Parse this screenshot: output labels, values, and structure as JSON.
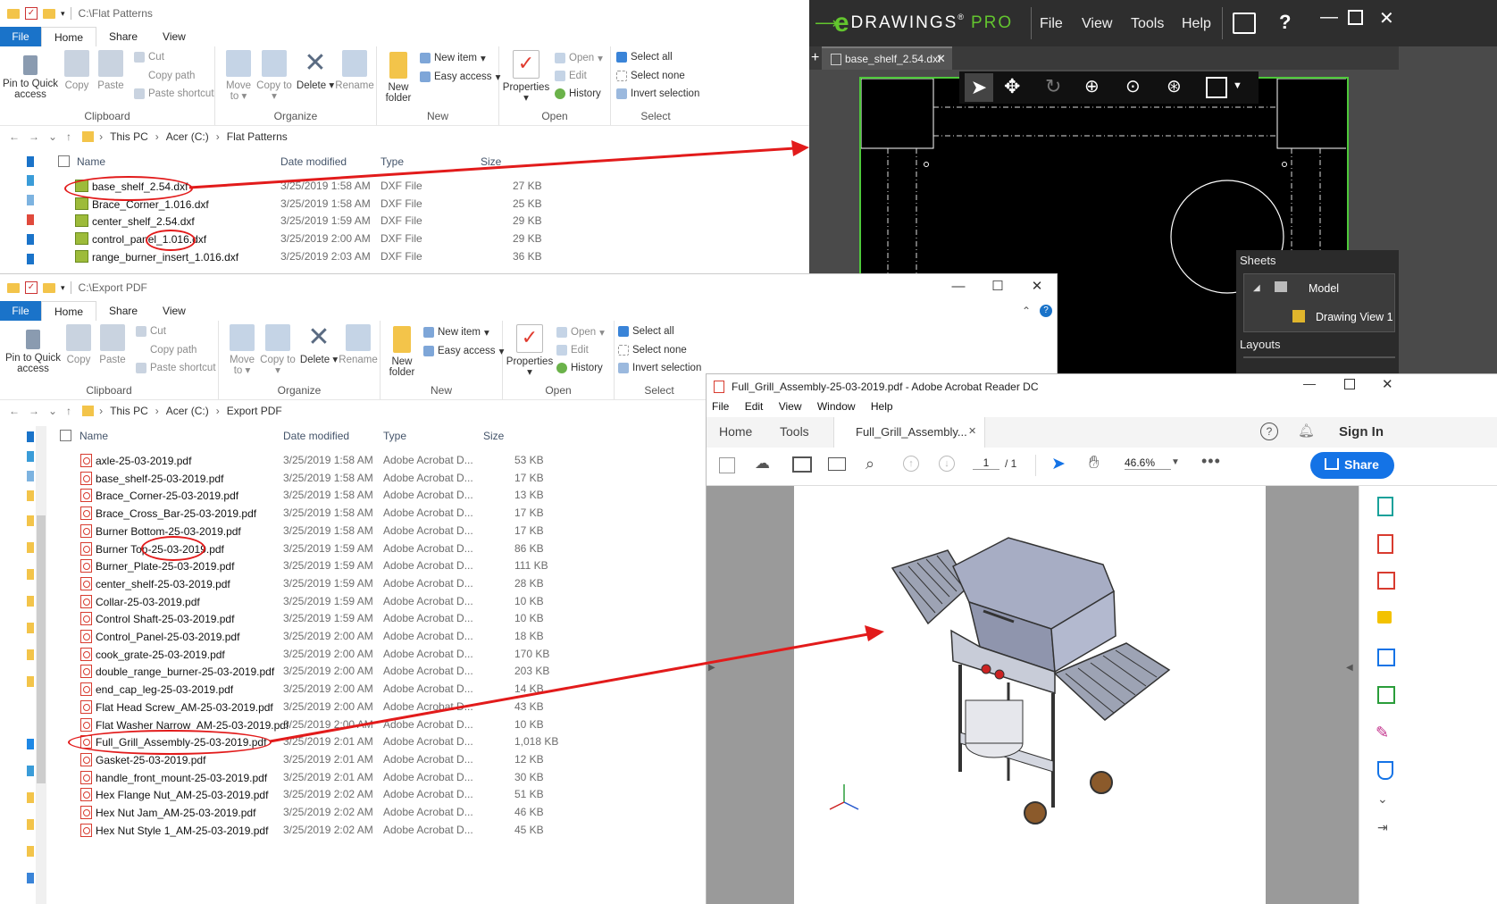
{
  "explorer_top": {
    "path": "C:\\Flat Patterns",
    "tabs": [
      "File",
      "Home",
      "Share",
      "View"
    ],
    "ribbon": {
      "clipboard": {
        "pin": "Pin to Quick access",
        "copy": "Copy",
        "paste": "Paste",
        "cut": "Cut",
        "copy_path": "Copy path",
        "paste_shortcut": "Paste shortcut",
        "label": "Clipboard"
      },
      "organize": {
        "move": "Move to",
        "copy_to": "Copy to",
        "delete": "Delete",
        "rename": "Rename",
        "label": "Organize"
      },
      "new": {
        "new_folder": "New folder",
        "new_item": "New item",
        "easy_access": "Easy access",
        "label": "New"
      },
      "open": {
        "properties": "Properties",
        "open": "Open",
        "edit": "Edit",
        "history": "History",
        "label": "Open"
      },
      "select": {
        "select_all": "Select all",
        "select_none": "Select none",
        "invert": "Invert selection",
        "label": "Select"
      }
    },
    "address": [
      "This PC",
      "Acer (C:)",
      "Flat Patterns"
    ],
    "columns": {
      "name": "Name",
      "date": "Date modified",
      "type": "Type",
      "size": "Size"
    },
    "files": [
      {
        "name": "base_shelf_2.54.dxf",
        "date": "3/25/2019 1:58 AM",
        "type": "DXF File",
        "size": "27 KB"
      },
      {
        "name": "Brace_Corner_1.016.dxf",
        "date": "3/25/2019 1:58 AM",
        "type": "DXF File",
        "size": "25 KB"
      },
      {
        "name": "center_shelf_2.54.dxf",
        "date": "3/25/2019 1:59 AM",
        "type": "DXF File",
        "size": "29 KB"
      },
      {
        "name": "control_panel_1.016.dxf",
        "date": "3/25/2019 2:00 AM",
        "type": "DXF File",
        "size": "29 KB"
      },
      {
        "name": "range_burner_insert_1.016.dxf",
        "date": "3/25/2019 2:03 AM",
        "type": "DXF File",
        "size": "36 KB"
      }
    ]
  },
  "explorer_bottom": {
    "path": "C:\\Export PDF",
    "tabs": [
      "File",
      "Home",
      "Share",
      "View"
    ],
    "address": [
      "This PC",
      "Acer (C:)",
      "Export PDF"
    ],
    "columns": {
      "name": "Name",
      "date": "Date modified",
      "type": "Type",
      "size": "Size"
    },
    "files": [
      {
        "name": "axle-25-03-2019.pdf",
        "date": "3/25/2019 1:58 AM",
        "type": "Adobe Acrobat D...",
        "size": "53 KB"
      },
      {
        "name": "base_shelf-25-03-2019.pdf",
        "date": "3/25/2019 1:58 AM",
        "type": "Adobe Acrobat D...",
        "size": "17 KB"
      },
      {
        "name": "Brace_Corner-25-03-2019.pdf",
        "date": "3/25/2019 1:58 AM",
        "type": "Adobe Acrobat D...",
        "size": "13 KB"
      },
      {
        "name": "Brace_Cross_Bar-25-03-2019.pdf",
        "date": "3/25/2019 1:58 AM",
        "type": "Adobe Acrobat D...",
        "size": "17 KB"
      },
      {
        "name": "Burner Bottom-25-03-2019.pdf",
        "date": "3/25/2019 1:58 AM",
        "type": "Adobe Acrobat D...",
        "size": "17 KB"
      },
      {
        "name": "Burner Top-25-03-2019.pdf",
        "date": "3/25/2019 1:59 AM",
        "type": "Adobe Acrobat D...",
        "size": "86 KB"
      },
      {
        "name": "Burner_Plate-25-03-2019.pdf",
        "date": "3/25/2019 1:59 AM",
        "type": "Adobe Acrobat D...",
        "size": "111 KB"
      },
      {
        "name": "center_shelf-25-03-2019.pdf",
        "date": "3/25/2019 1:59 AM",
        "type": "Adobe Acrobat D...",
        "size": "28 KB"
      },
      {
        "name": "Collar-25-03-2019.pdf",
        "date": "3/25/2019 1:59 AM",
        "type": "Adobe Acrobat D...",
        "size": "10 KB"
      },
      {
        "name": "Control Shaft-25-03-2019.pdf",
        "date": "3/25/2019 1:59 AM",
        "type": "Adobe Acrobat D...",
        "size": "10 KB"
      },
      {
        "name": "Control_Panel-25-03-2019.pdf",
        "date": "3/25/2019 2:00 AM",
        "type": "Adobe Acrobat D...",
        "size": "18 KB"
      },
      {
        "name": "cook_grate-25-03-2019.pdf",
        "date": "3/25/2019 2:00 AM",
        "type": "Adobe Acrobat D...",
        "size": "170 KB"
      },
      {
        "name": "double_range_burner-25-03-2019.pdf",
        "date": "3/25/2019 2:00 AM",
        "type": "Adobe Acrobat D...",
        "size": "203 KB"
      },
      {
        "name": "end_cap_leg-25-03-2019.pdf",
        "date": "3/25/2019 2:00 AM",
        "type": "Adobe Acrobat D...",
        "size": "14 KB"
      },
      {
        "name": "Flat Head Screw_AM-25-03-2019.pdf",
        "date": "3/25/2019 2:00 AM",
        "type": "Adobe Acrobat D...",
        "size": "43 KB"
      },
      {
        "name": "Flat Washer Narrow_AM-25-03-2019.pdf",
        "date": "3/25/2019 2:00 AM",
        "type": "Adobe Acrobat D...",
        "size": "10 KB"
      },
      {
        "name": "Full_Grill_Assembly-25-03-2019.pdf",
        "date": "3/25/2019 2:01 AM",
        "type": "Adobe Acrobat D...",
        "size": "1,018 KB"
      },
      {
        "name": "Gasket-25-03-2019.pdf",
        "date": "3/25/2019 2:01 AM",
        "type": "Adobe Acrobat D...",
        "size": "12 KB"
      },
      {
        "name": "handle_front_mount-25-03-2019.pdf",
        "date": "3/25/2019 2:01 AM",
        "type": "Adobe Acrobat D...",
        "size": "30 KB"
      },
      {
        "name": "Hex Flange Nut_AM-25-03-2019.pdf",
        "date": "3/25/2019 2:02 AM",
        "type": "Adobe Acrobat D...",
        "size": "51 KB"
      },
      {
        "name": "Hex Nut Jam_AM-25-03-2019.pdf",
        "date": "3/25/2019 2:02 AM",
        "type": "Adobe Acrobat D...",
        "size": "46 KB"
      },
      {
        "name": "Hex Nut Style 1_AM-25-03-2019.pdf",
        "date": "3/25/2019 2:02 AM",
        "type": "Adobe Acrobat D...",
        "size": "45 KB"
      }
    ]
  },
  "edrawings": {
    "logo_e": "e",
    "logo_text": "DRAWINGS",
    "logo_pro": "PRO",
    "menu": [
      "File",
      "View",
      "Tools",
      "Help"
    ],
    "tab": "base_shelf_2.54.dxf",
    "sheets_title": "Sheets",
    "model": "Model",
    "drawing_view": "Drawing View 1",
    "layouts": "Layouts"
  },
  "acrobat": {
    "title": "Full_Grill_Assembly-25-03-2019.pdf - Adobe Acrobat Reader DC",
    "menu": [
      "File",
      "Edit",
      "View",
      "Window",
      "Help"
    ],
    "tab_home": "Home",
    "tab_tools": "Tools",
    "doc_tab": "Full_Grill_Assembly...",
    "sign_in": "Sign In",
    "page_current": "1",
    "page_total": "/ 1",
    "zoom": "46.6%",
    "share": "Share"
  },
  "colors": {
    "accent": "#1a73c9",
    "annotation": "#e21b1b",
    "edrawings_green": "#4ec93a",
    "acrobat_share": "#1473e6"
  }
}
